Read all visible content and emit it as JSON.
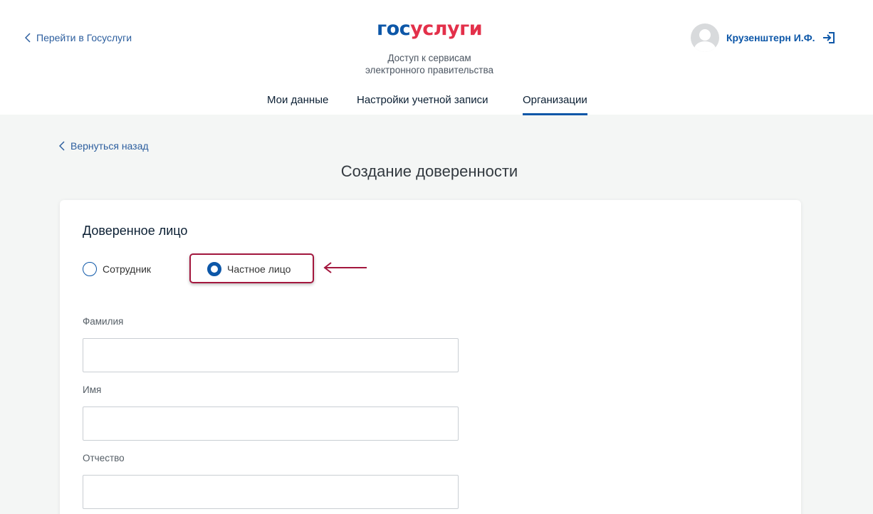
{
  "header": {
    "back_link": "Перейти в Госуслуги",
    "logo_part1": "гос",
    "logo_part2": "услуги",
    "subtitle_line1": "Доступ к сервисам",
    "subtitle_line2": "электронного правительства",
    "user_name": "Крузенштерн И.Ф."
  },
  "nav": {
    "items": [
      {
        "label": "Мои данные",
        "active": false
      },
      {
        "label": "Настройки учетной записи",
        "active": false
      },
      {
        "label": "Организации",
        "active": true
      }
    ]
  },
  "content": {
    "back_link": "Вернуться назад",
    "title": "Создание доверенности"
  },
  "form": {
    "section_title": "Доверенное лицо",
    "options": [
      {
        "label": "Сотрудник",
        "selected": false
      },
      {
        "label": "Частное лицо",
        "selected": true
      }
    ],
    "fields": [
      {
        "label": "Фамилия",
        "value": ""
      },
      {
        "label": "Имя",
        "value": ""
      },
      {
        "label": "Отчество",
        "value": ""
      }
    ]
  },
  "colors": {
    "brand_blue": "#0d57a8",
    "brand_red": "#e3304a",
    "highlight": "#a3173e",
    "background": "#f4f6f5"
  },
  "icons": {
    "back": "chevron-left-icon",
    "logout": "logout-icon",
    "avatar": "user-avatar-icon",
    "annotation": "arrow-left-icon"
  }
}
